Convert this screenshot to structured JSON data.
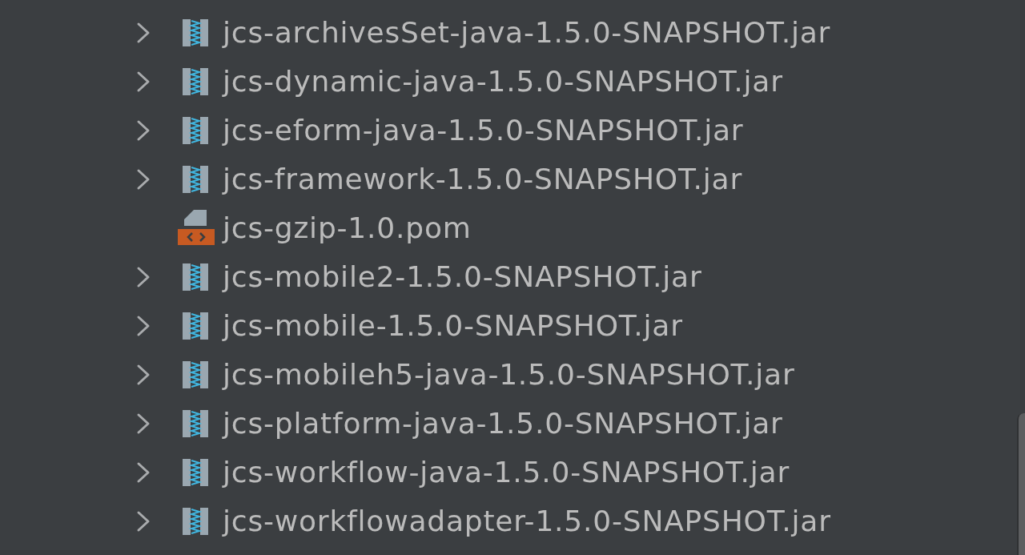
{
  "tree": {
    "items": [
      {
        "kind": "jar",
        "label": "jcs-archivesSet-java-1.5.0-SNAPSHOT.jar",
        "expandable": true
      },
      {
        "kind": "jar",
        "label": "jcs-dynamic-java-1.5.0-SNAPSHOT.jar",
        "expandable": true
      },
      {
        "kind": "jar",
        "label": "jcs-eform-java-1.5.0-SNAPSHOT.jar",
        "expandable": true
      },
      {
        "kind": "jar",
        "label": "jcs-framework-1.5.0-SNAPSHOT.jar",
        "expandable": true
      },
      {
        "kind": "pom",
        "label": "jcs-gzip-1.0.pom",
        "expandable": false
      },
      {
        "kind": "jar",
        "label": "jcs-mobile2-1.5.0-SNAPSHOT.jar",
        "expandable": true
      },
      {
        "kind": "jar",
        "label": "jcs-mobile-1.5.0-SNAPSHOT.jar",
        "expandable": true
      },
      {
        "kind": "jar",
        "label": "jcs-mobileh5-java-1.5.0-SNAPSHOT.jar",
        "expandable": true
      },
      {
        "kind": "jar",
        "label": "jcs-platform-java-1.5.0-SNAPSHOT.jar",
        "expandable": true
      },
      {
        "kind": "jar",
        "label": "jcs-workflow-java-1.5.0-SNAPSHOT.jar",
        "expandable": true
      },
      {
        "kind": "jar",
        "label": "jcs-workflowadapter-1.5.0-SNAPSHOT.jar",
        "expandable": true
      }
    ]
  }
}
